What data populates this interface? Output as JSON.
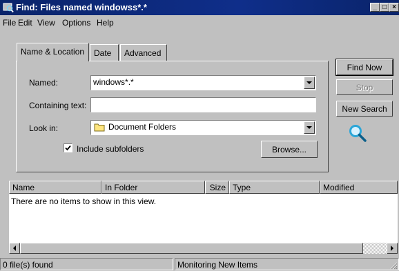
{
  "window": {
    "title": "Find: Files named windowss*.*",
    "minimize_glyph": "_",
    "maximize_glyph": "□",
    "close_glyph": "×"
  },
  "menu": [
    "File",
    "Edit",
    "View",
    "Options",
    "Help"
  ],
  "tabs": [
    "Name & Location",
    "Date",
    "Advanced"
  ],
  "form": {
    "named_label": "Named:",
    "named_value": "windows*.*",
    "containing_label": "Containing text:",
    "containing_value": "",
    "lookin_label": "Look in:",
    "lookin_value": "Document Folders",
    "subfolders_label": "Include subfolders",
    "subfolders_checked": true,
    "browse_label": "Browse..."
  },
  "buttons": {
    "find_now": "Find Now",
    "stop": "Stop",
    "new_search": "New Search"
  },
  "results": {
    "columns": [
      "Name",
      "In Folder",
      "Size",
      "Type",
      "Modified"
    ],
    "empty_message": "There are no items to show in this view."
  },
  "status": {
    "count": "0 file(s) found",
    "monitoring": "Monitoring New Items"
  },
  "colors": {
    "title_bar": "#0a246a",
    "face": "#c0c0c0",
    "folder_yellow": "#ffe680",
    "magnifier": "#2aa6d8"
  },
  "icons": [
    "find-app-icon",
    "folder-icon",
    "magnifier-icon",
    "checkbox-check-icon",
    "dropdown-arrow-icon"
  ]
}
